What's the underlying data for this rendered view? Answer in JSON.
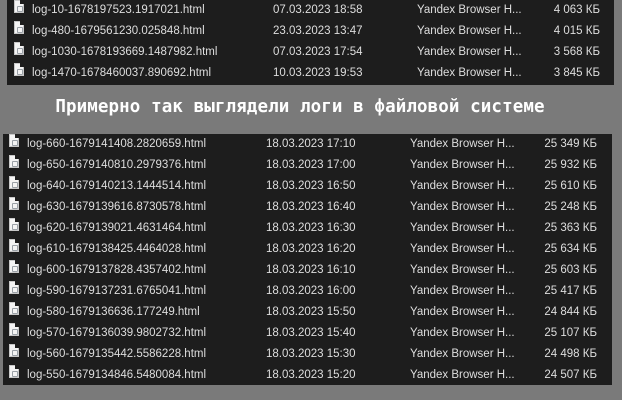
{
  "caption": "Примерно так выглядели логи в файловой системе",
  "top_files": [
    {
      "name": "log-10-1678197523.1917021.html",
      "date": "07.03.2023 18:58",
      "type": "Yandex Browser H...",
      "size": "4 063 КБ"
    },
    {
      "name": "log-480-1679561230.025848.html",
      "date": "23.03.2023 13:47",
      "type": "Yandex Browser H...",
      "size": "4 015 КБ"
    },
    {
      "name": "log-1030-1678193669.1487982.html",
      "date": "07.03.2023 17:54",
      "type": "Yandex Browser H...",
      "size": "3 568 КБ"
    },
    {
      "name": "log-1470-1678460037.890692.html",
      "date": "10.03.2023 19:53",
      "type": "Yandex Browser H...",
      "size": "3 845 КБ"
    }
  ],
  "bottom_files": [
    {
      "name": "log-660-1679141408.2820659.html",
      "date": "18.03.2023 17:10",
      "type": "Yandex Browser H...",
      "size": "25 349 КБ"
    },
    {
      "name": "log-650-1679140810.2979376.html",
      "date": "18.03.2023 17:00",
      "type": "Yandex Browser H...",
      "size": "25 932 КБ"
    },
    {
      "name": "log-640-1679140213.1444514.html",
      "date": "18.03.2023 16:50",
      "type": "Yandex Browser H...",
      "size": "25 610 КБ"
    },
    {
      "name": "log-630-1679139616.8730578.html",
      "date": "18.03.2023 16:40",
      "type": "Yandex Browser H...",
      "size": "25 248 КБ"
    },
    {
      "name": "log-620-1679139021.4631464.html",
      "date": "18.03.2023 16:30",
      "type": "Yandex Browser H...",
      "size": "25 363 КБ"
    },
    {
      "name": "log-610-1679138425.4464028.html",
      "date": "18.03.2023 16:20",
      "type": "Yandex Browser H...",
      "size": "25 634 КБ"
    },
    {
      "name": "log-600-1679137828.4357402.html",
      "date": "18.03.2023 16:10",
      "type": "Yandex Browser H...",
      "size": "25 603 КБ"
    },
    {
      "name": "log-590-1679137231.6765041.html",
      "date": "18.03.2023 16:00",
      "type": "Yandex Browser H...",
      "size": "25 417 КБ"
    },
    {
      "name": "log-580-1679136636.177249.html",
      "date": "18.03.2023 15:50",
      "type": "Yandex Browser H...",
      "size": "24 844 КБ"
    },
    {
      "name": "log-570-1679136039.9802732.html",
      "date": "18.03.2023 15:40",
      "type": "Yandex Browser H...",
      "size": "25 107 КБ"
    },
    {
      "name": "log-560-1679135442.5586228.html",
      "date": "18.03.2023 15:30",
      "type": "Yandex Browser H...",
      "size": "24 498 КБ"
    },
    {
      "name": "log-550-1679134846.5480084.html",
      "date": "18.03.2023 15:20",
      "type": "Yandex Browser H...",
      "size": "24 507 КБ"
    }
  ],
  "icons": {
    "file": "html-file-icon"
  }
}
